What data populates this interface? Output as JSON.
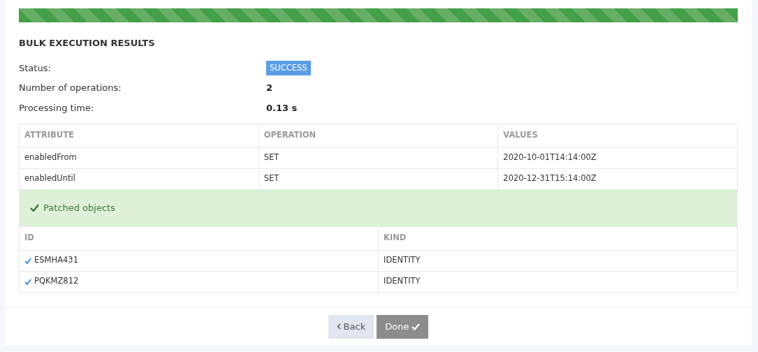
{
  "progress": {
    "level": 1
  },
  "title": "BULK EXECUTION RESULTS",
  "summary": [
    {
      "label": "Status:",
      "value": "SUCCESS",
      "kind": "badge"
    },
    {
      "label": "Number of operations:",
      "value": "2",
      "kind": "text"
    },
    {
      "label": "Processing time:",
      "value": "0.13 s",
      "kind": "text"
    }
  ],
  "operations_table": {
    "columns": [
      "ATTRIBUTE",
      "OPERATION",
      "VALUES"
    ],
    "rows": [
      [
        "enabledFrom",
        "SET",
        "2020-10-01T14:14:00Z"
      ],
      [
        "enabledUntil",
        "SET",
        "2020-12-31T15:14:00Z"
      ]
    ]
  },
  "patched_banner": "Patched objects",
  "objects_table": {
    "columns": [
      "ID",
      "KIND"
    ],
    "rows": [
      {
        "id": "ESMHA431",
        "kind_value": "IDENTITY",
        "patched": true
      },
      {
        "id": "PQKMZ812",
        "kind_value": "IDENTITY",
        "patched": true
      }
    ]
  },
  "buttons": [
    {
      "label": "Back",
      "kind": "back",
      "disabled": false
    },
    {
      "label": "Done",
      "kind": "done",
      "disabled": true
    }
  ]
}
